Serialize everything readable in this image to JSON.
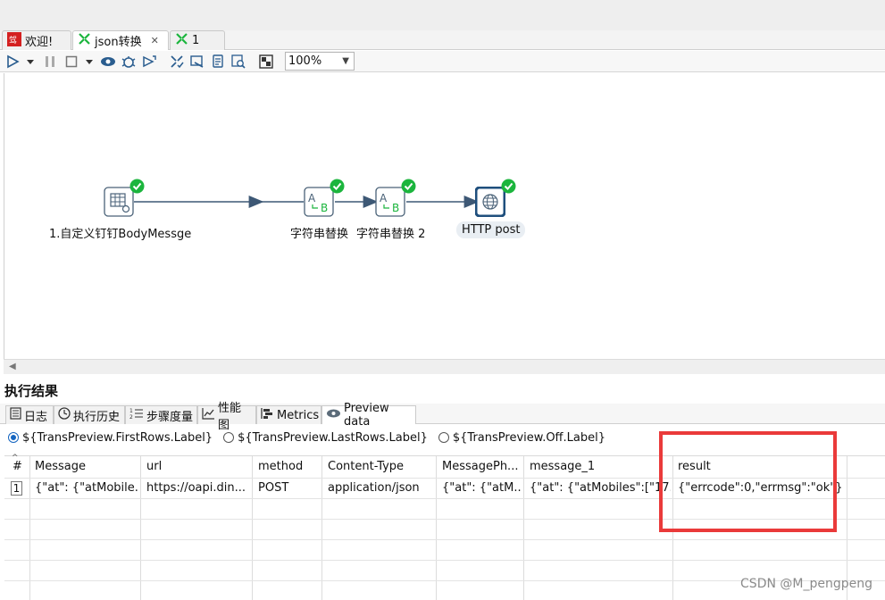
{
  "tabs": [
    {
      "label": "欢迎!",
      "icon": "app-logo-icon"
    },
    {
      "label": "json转换",
      "icon": "transformation-icon",
      "close": "✕"
    },
    {
      "label": "1",
      "icon": "transformation-icon"
    }
  ],
  "toolbar": {
    "zoom": "100%",
    "icons": [
      "run-icon",
      "run-dropdown-icon",
      "pause-icon",
      "stop-icon",
      "stop-dropdown-icon",
      "preview-icon",
      "debug-icon",
      "replay-icon",
      "verify-icon",
      "impact-icon",
      "sql-icon",
      "explore-db-icon",
      "show-results-icon"
    ]
  },
  "canvas": {
    "nodes": [
      {
        "label": "1.自定义钉钉BodyMessge",
        "type": "table-input"
      },
      {
        "label": "字符串替换",
        "type": "string-replace"
      },
      {
        "label": "字符串替换 2",
        "type": "string-replace"
      },
      {
        "label": "HTTP post",
        "type": "http-post"
      }
    ]
  },
  "results": {
    "title": "执行结果",
    "tabs": [
      "日志",
      "执行历史",
      "步骤度量",
      "性能图",
      "Metrics",
      "Preview data"
    ],
    "radios": [
      "${TransPreview.FirstRows.Label}",
      "${TransPreview.LastRows.Label}",
      "${TransPreview.Off.Label}"
    ],
    "selected_radio": 0,
    "columns": [
      "#",
      "Message",
      "url",
      "method",
      "Content-Type",
      "MessagePh...",
      "message_1",
      "result"
    ],
    "rows": [
      [
        "1",
        "{\"at\": {\"atMobile...",
        "https://oapi.din...",
        "POST",
        "application/json",
        "{\"at\": {\"atM...",
        "{\"at\": {\"atMobiles\":[\"17...",
        "{\"errcode\":0,\"errmsg\":\"ok\"}"
      ]
    ]
  },
  "watermark": "CSDN @M_pengpeng",
  "colors": {
    "highlight": "#ea3a3a",
    "accent": "#1565c0",
    "ok": "#1bb53d"
  }
}
